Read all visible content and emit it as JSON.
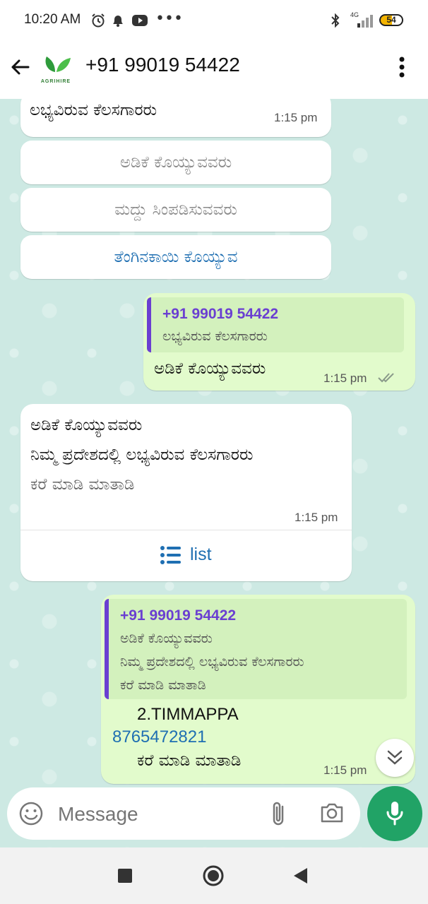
{
  "status_bar": {
    "time": "10:20 AM",
    "network": "4G",
    "battery": "54"
  },
  "header": {
    "title": "+91 99019 54422",
    "logo_text": "AGRIHIRE"
  },
  "messages": {
    "m1": {
      "text": "ಲಭ್ಯವಿರುವ ಕೆಲಸಗಾರರು",
      "time": "1:15 pm"
    },
    "buttons": [
      {
        "label": "ಅಡಿಕೆ ಕೊಯ್ಯುವವರು"
      },
      {
        "label": "ಮದ್ದು ಸಿಂಪಡಿಸುವವರು"
      },
      {
        "label": "ತೆಂಗಿನಕಾಯಿ  ಕೊಯ್ಯುವ"
      }
    ],
    "m2": {
      "quote_name": "+91 99019 54422",
      "quote_text": "ಲಭ್ಯವಿರುವ ಕೆಲಸಗಾರರು",
      "text": "ಅಡಿಕೆ ಕೊಯ್ಯುವವರು",
      "time": "1:15 pm"
    },
    "m3": {
      "line1": "ಅಡಿಕೆ ಕೊಯ್ಯುವವರು",
      "line2": "ನಿಮ್ಮ ಪ್ರದೇಶದಲ್ಲಿ ಲಭ್ಯವಿರುವ ಕೆಲಸಗಾರರು",
      "line3": "ಕರೆ ಮಾಡಿ ಮಾತಾಡಿ",
      "time": "1:15 pm",
      "list_label": "list"
    },
    "m4": {
      "quote_name": "+91 99019 54422",
      "quote_line1": "ಅಡಿಕೆ ಕೊಯ್ಯುವವರು",
      "quote_line2": "ನಿಮ್ಮ ಪ್ರದೇಶದಲ್ಲಿ ಲಭ್ಯವಿರುವ ಕೆಲಸಗಾರರು",
      "quote_line3": "ಕರೆ ಮಾಡಿ ಮಾತಾಡಿ",
      "name": "2.TIMMAPPA",
      "phone": "8765472821",
      "text": "ಕರೆ ಮಾಡಿ ಮಾತಾಡಿ",
      "time": "1:15 pm"
    }
  },
  "composer": {
    "placeholder": "Message"
  },
  "colors": {
    "accent_green": "#21a366",
    "link_blue": "#1f6fb2",
    "quote_purple": "#6a3fd1",
    "chat_bg": "#cde9e3",
    "outgoing_bubble": "#e2fbcc"
  }
}
